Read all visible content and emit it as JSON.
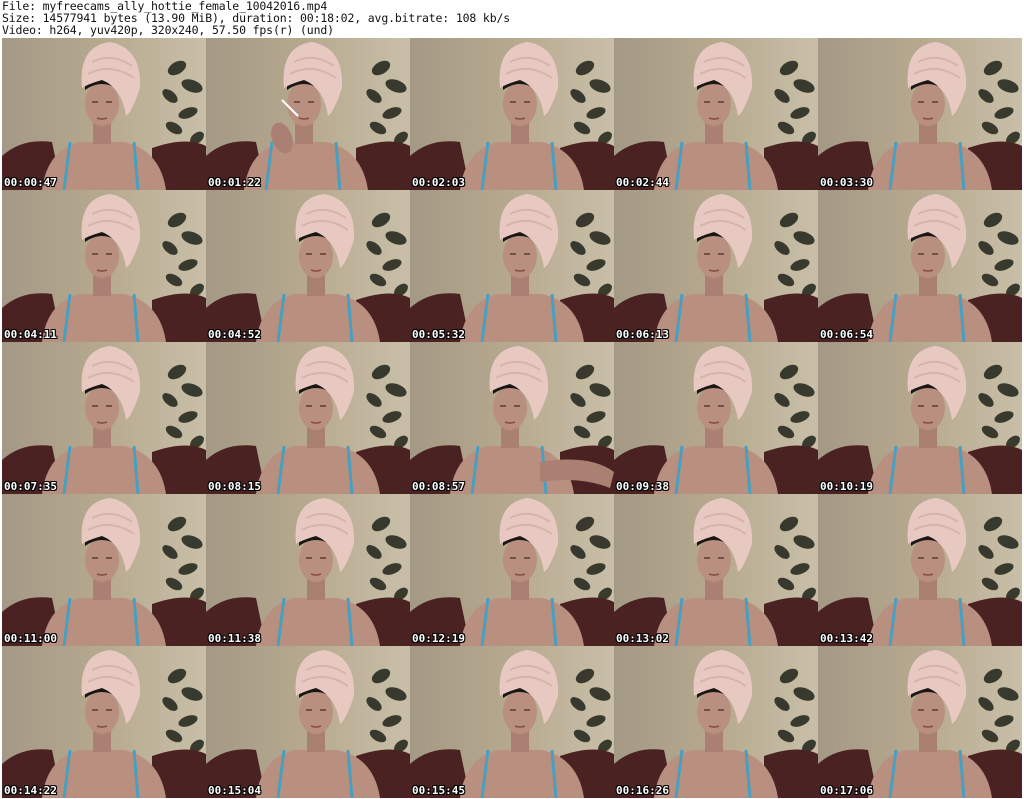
{
  "header": {
    "file_line": "File: myfreecams_ally_hottie_female_10042016.mp4",
    "size_line": "Size: 14577941 bytes (13.90 MiB), duration: 00:18:02, avg.bitrate: 108 kb/s",
    "video_line": "Video: h264, yuv420p, 320x240, 57.50 fps(r) (und)"
  },
  "grid": {
    "columns": 5,
    "rows": 5
  },
  "thumbnails": [
    {
      "timestamp": "00:00:47",
      "variant": "a"
    },
    {
      "timestamp": "00:01:22",
      "variant": "smoke"
    },
    {
      "timestamp": "00:02:03",
      "variant": "b"
    },
    {
      "timestamp": "00:02:44",
      "variant": "a"
    },
    {
      "timestamp": "00:03:30",
      "variant": "b"
    },
    {
      "timestamp": "00:04:11",
      "variant": "a"
    },
    {
      "timestamp": "00:04:52",
      "variant": "b"
    },
    {
      "timestamp": "00:05:32",
      "variant": "b"
    },
    {
      "timestamp": "00:06:13",
      "variant": "a"
    },
    {
      "timestamp": "00:06:54",
      "variant": "b"
    },
    {
      "timestamp": "00:07:35",
      "variant": "a"
    },
    {
      "timestamp": "00:08:15",
      "variant": "b"
    },
    {
      "timestamp": "00:08:57",
      "variant": "arm"
    },
    {
      "timestamp": "00:09:38",
      "variant": "a"
    },
    {
      "timestamp": "00:10:19",
      "variant": "b"
    },
    {
      "timestamp": "00:11:00",
      "variant": "a"
    },
    {
      "timestamp": "00:11:38",
      "variant": "b"
    },
    {
      "timestamp": "00:12:19",
      "variant": "b"
    },
    {
      "timestamp": "00:13:02",
      "variant": "a"
    },
    {
      "timestamp": "00:13:42",
      "variant": "b"
    },
    {
      "timestamp": "00:14:22",
      "variant": "a"
    },
    {
      "timestamp": "00:15:04",
      "variant": "b"
    },
    {
      "timestamp": "00:15:45",
      "variant": "b"
    },
    {
      "timestamp": "00:16:26",
      "variant": "a"
    },
    {
      "timestamp": "00:17:06",
      "variant": "b"
    }
  ],
  "colors": {
    "wall": "#b6a98f",
    "sofa": "#4a2222",
    "skin": "#b98f80",
    "towel": "#e8c9c2",
    "strap": "#4a9fc0",
    "plant": "#2a2c22",
    "timestamp_text": "#ffffff"
  }
}
